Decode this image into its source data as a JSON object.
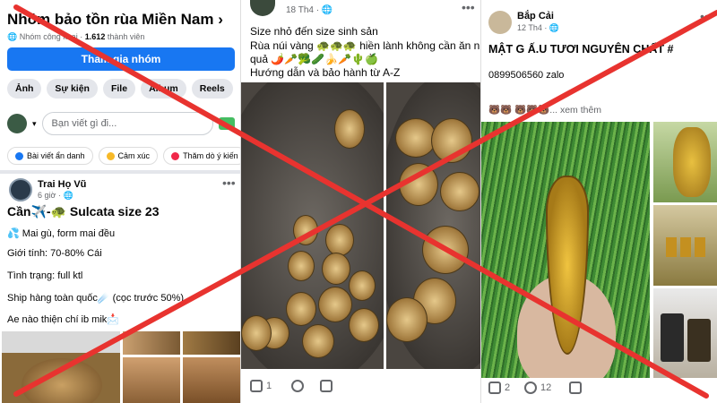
{
  "panel1": {
    "group_title": "Nhóm bảo tồn rùa Miền Nam",
    "title_chevron": "›",
    "group_meta_prefix": "Nhóm công khai ·",
    "member_count": "1.612",
    "member_suffix": "thành viên",
    "join_button": "Tham gia nhóm",
    "tabs": [
      "Ảnh",
      "Sự kiện",
      "File",
      "Album",
      "Reels"
    ],
    "composer_placeholder": "Bạn viết gì đi...",
    "chips": [
      "Bài viết ẩn danh",
      "Cảm xúc",
      "Thăm dò ý kiến"
    ],
    "post": {
      "author": "Trai Họ Vũ",
      "time": "6 giờ ·",
      "headline": "Cần✈️-🐢 Sulcata size 23",
      "lines": [
        "💦 Mai gù, form mai đều",
        "Giới tính: 70-80% Cái",
        "Tình trạng: full ktl",
        "Ship hàng toàn quốc☄️ (cọc trước 50%)",
        "Ae nào thiện chí ib mik📩"
      ]
    }
  },
  "panel2": {
    "time": "18 Th4 ·",
    "text_lines": [
      "Size nhỏ đến size sinh sản",
      "Rùa núi vàng 🐢🐢🐢 hiền lành không cần ăn n",
      "quả 🌶️🥕🥦🥒🍌🥕🌵🍏",
      "Hướng dẫn và bảo hành từ A-Z"
    ],
    "like_count": "1"
  },
  "panel3": {
    "author": "Bắp Cải",
    "time": "12 Th4 ·",
    "headline": "MẬT G   Ấ.U TƯƠI NGUYÊN CHẤT #",
    "phone": "0899506560 zalo",
    "more_line": "🐻🐻 🐻🐻🐻... xem thêm",
    "like_count": "2",
    "comment_count": "12"
  },
  "colors": {
    "facebook_blue": "#1877f2",
    "cross_red": "#e8332f",
    "muted_text": "#65676b"
  },
  "icons": [
    "globe-icon",
    "chevron-down-icon",
    "gallery-icon",
    "more-icon",
    "like-icon",
    "comment-icon",
    "share-icon"
  ]
}
